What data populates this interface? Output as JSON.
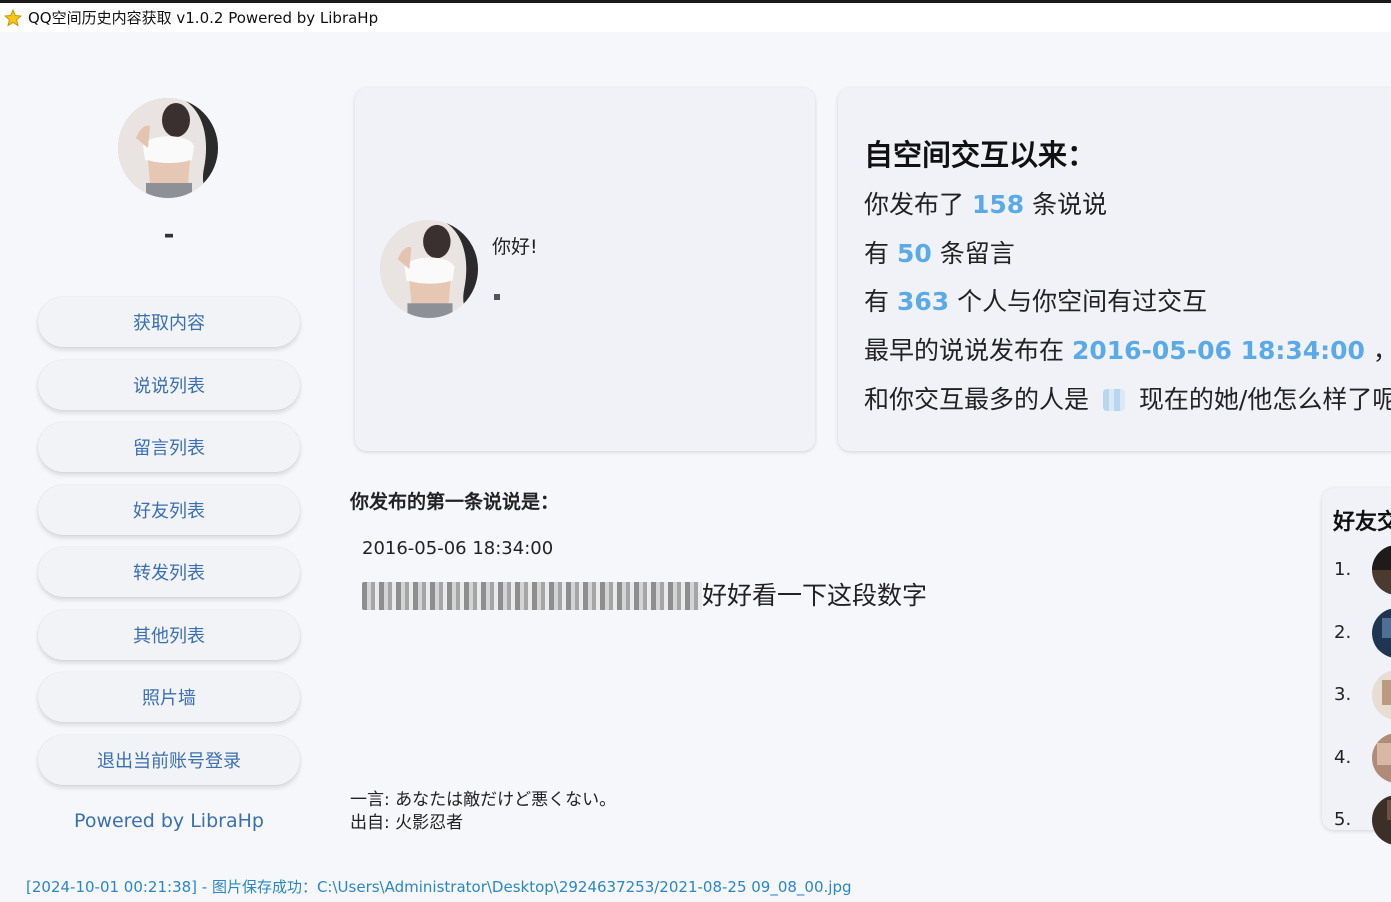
{
  "window": {
    "title": "QQ空间历史内容获取 v1.0.2 Powered by LibraHp"
  },
  "sidebar": {
    "nickname": "-",
    "nav": [
      {
        "label": "获取内容"
      },
      {
        "label": "说说列表"
      },
      {
        "label": "留言列表"
      },
      {
        "label": "好友列表"
      },
      {
        "label": "转发列表"
      },
      {
        "label": "其他列表"
      },
      {
        "label": "照片墙"
      },
      {
        "label": "退出当前账号登录"
      }
    ],
    "powered": "Powered by LibraHp"
  },
  "hello": {
    "greeting": "你好!"
  },
  "stats": {
    "heading": "自空间交互以来：",
    "line1_pre": "你发布了 ",
    "posts": "158",
    "line1_post": " 条说说",
    "line2_pre": "有 ",
    "messages": "50",
    "line2_post": " 条留言",
    "line3_pre": "有 ",
    "people": "363",
    "line3_post": " 个人与你空间有过交互",
    "line4_pre": "最早的说说发布在 ",
    "earliest": "2016-05-06 18:34:00",
    "line4_post": " ， 那",
    "line5_pre": "和你交互最多的人是 ",
    "line5_post": " 现在的她/他怎么样了呢"
  },
  "first_post": {
    "label": "你发布的第一条说说是：",
    "date": "2016-05-06 18:34:00",
    "text": "好好看一下这段数字"
  },
  "quote": {
    "line1": "一言: あなたは敵だけど悪くない。",
    "line2": "出自: 火影忍者"
  },
  "friends": {
    "title": "好友交",
    "items": [
      {
        "rank": "1."
      },
      {
        "rank": "2."
      },
      {
        "rank": "3."
      },
      {
        "rank": "4."
      },
      {
        "rank": "5."
      }
    ]
  },
  "status": {
    "text": "[2024-10-01 00:21:38] - 图片保存成功：C:\\Users\\Administrator\\Desktop\\2924637253/2021-08-25 09_08_00.jpg"
  },
  "colors": {
    "accent": "#5aaae8",
    "link": "#3a6fb0",
    "status": "#2b86c5",
    "background": "#f6f7fb"
  }
}
